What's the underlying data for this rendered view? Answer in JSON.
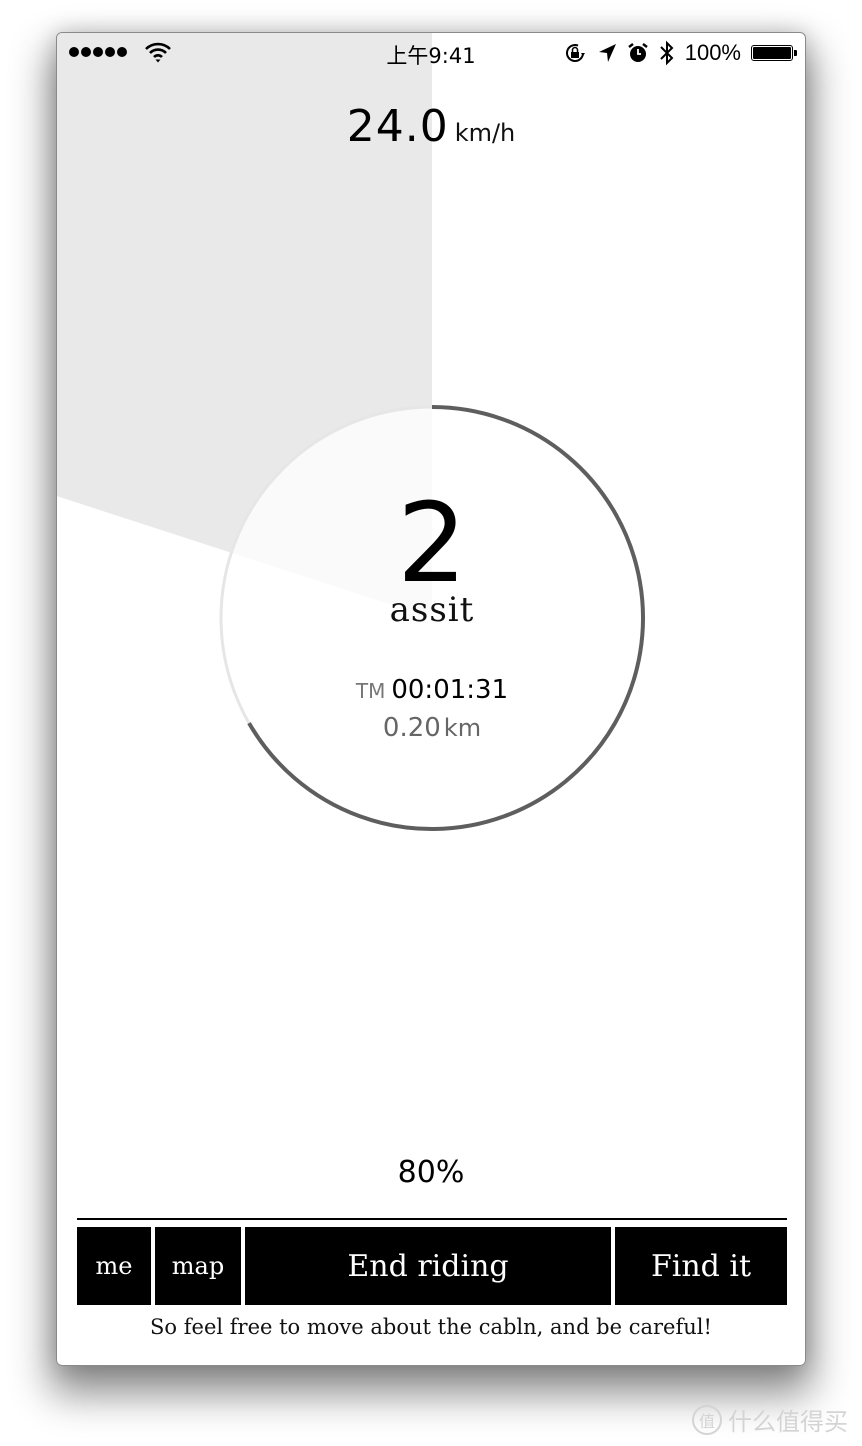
{
  "status_bar": {
    "signal_dots": 5,
    "time": "上午9:41",
    "icons": [
      "signal-dots",
      "wifi-icon",
      "rotation-lock-icon",
      "location-arrow-icon",
      "alarm-icon",
      "bluetooth-icon",
      "battery-icon"
    ],
    "battery_percent": "100%",
    "battery_fill": 1.0
  },
  "speed": {
    "value": "24.0",
    "unit": "km/h"
  },
  "gauge": {
    "progress_fraction": 0.667,
    "speed_wedge_fraction": 0.2,
    "ring_color": "#5e5e5e",
    "track_color": "#e6e6e6",
    "wedge_color": "#e9e9e9"
  },
  "assist": {
    "level": "2",
    "label": "assit"
  },
  "ride": {
    "time_prefix": "TM",
    "time": "00:01:31",
    "distance": "0.20",
    "distance_unit": "km"
  },
  "battery_level": "80%",
  "tabs": {
    "me": "me",
    "map": "map",
    "end": "End riding",
    "find": "Find it"
  },
  "tip": "So feel free to move about the cabln, and be careful!",
  "watermark": {
    "badge": "值",
    "text": "什么值得买"
  }
}
